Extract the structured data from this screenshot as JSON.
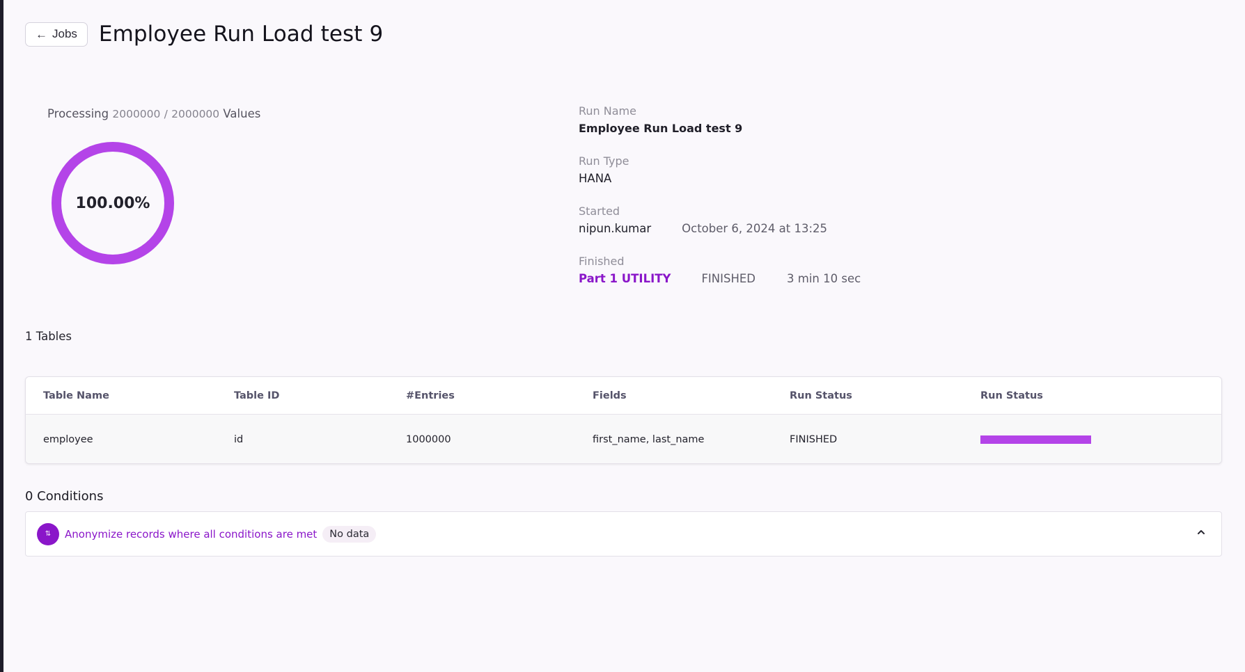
{
  "header": {
    "back_label": "Jobs",
    "title": "Employee Run Load test 9"
  },
  "progress": {
    "prefix": "Processing",
    "processed": "2000000",
    "separator": "/",
    "total": "2000000",
    "suffix": "Values",
    "percent_text": "100.00%",
    "fraction": 1.0,
    "color": "#b444e8"
  },
  "run_info": {
    "run_name_label": "Run Name",
    "run_name": "Employee Run Load test 9",
    "run_type_label": "Run Type",
    "run_type": "HANA",
    "started_label": "Started",
    "started_by": "nipun.kumar",
    "started_at": "October 6, 2024 at 13:25",
    "finished_label": "Finished",
    "finished_link": "Part 1 UTILITY",
    "finished_status": "FINISHED",
    "duration": "3 min 10 sec"
  },
  "tables": {
    "count_label": "1 Tables",
    "columns": [
      "Table Name",
      "Table ID",
      "#Entries",
      "Fields",
      "Run Status",
      "Run Status"
    ],
    "rows": [
      {
        "table_name": "employee",
        "table_id": "id",
        "entries": "1000000",
        "fields": "first_name, last_name",
        "run_status": "FINISHED",
        "progress_fraction": 1.0
      }
    ]
  },
  "conditions": {
    "title": "0 Conditions",
    "rule_text": "Anonymize records where all conditions are met",
    "badge": "No data",
    "icon": "sort-icon"
  },
  "colors": {
    "accent": "#8a16c9",
    "progress": "#b444e8"
  }
}
